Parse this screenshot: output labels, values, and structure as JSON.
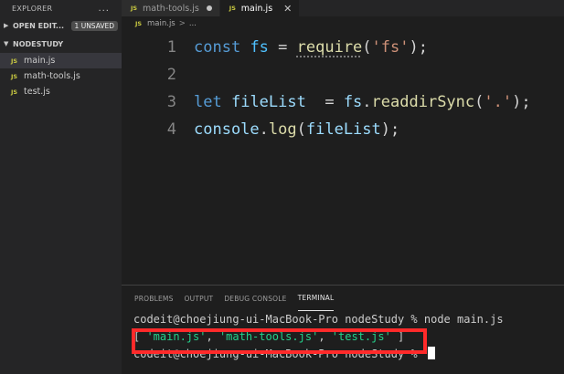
{
  "sidebar": {
    "title": "EXPLORER",
    "more_icon": "...",
    "open_editors": {
      "label": "OPEN EDIT...",
      "badge": "1 UNSAVED"
    },
    "project": {
      "label": "NODESTUDY"
    },
    "files": [
      {
        "badge": "JS",
        "name": "main.js"
      },
      {
        "badge": "JS",
        "name": "math-tools.js"
      },
      {
        "badge": "JS",
        "name": "test.js"
      }
    ]
  },
  "tabs": [
    {
      "badge": "JS",
      "name": "math-tools.js"
    },
    {
      "badge": "JS",
      "name": "main.js"
    }
  ],
  "breadcrumb": {
    "badge": "JS",
    "file": "main.js",
    "sep": ">",
    "rest": "..."
  },
  "code": {
    "line_numbers": [
      "1",
      "2",
      "3",
      "4"
    ],
    "l1": {
      "kw": "const",
      "var": "fs",
      "eq": " = ",
      "fn": "require",
      "p1": "(",
      "str": "'fs'",
      "p2": ");"
    },
    "l3": {
      "kw": "let",
      "var": "fileList",
      "eq": "  = ",
      "obj": "fs",
      "dot": ".",
      "fn": "readdirSync",
      "p1": "(",
      "str": "'.'",
      "p2": ");"
    },
    "l4": {
      "obj": "console",
      "dot": ".",
      "fn": "log",
      "p1": "(",
      "arg": "fileList",
      "p2": ");"
    }
  },
  "panel": {
    "tabs": [
      "PROBLEMS",
      "OUTPUT",
      "DEBUG CONSOLE",
      "TERMINAL"
    ],
    "active_tab": "TERMINAL",
    "terminal": {
      "line1": "codeit@choejiung-ui-MacBook-Pro nodeStudy % node main.js",
      "out_open": "[ ",
      "out_items": [
        "'main.js'",
        "'math-tools.js'",
        "'test.js'"
      ],
      "out_sep": ", ",
      "out_close": " ]",
      "line3": "codeit@choejiung-ui-MacBook-Pro nodeStudy % "
    }
  },
  "colors": {
    "highlight_box": "#ff2a2a",
    "js_badge": "#cbcb41"
  }
}
